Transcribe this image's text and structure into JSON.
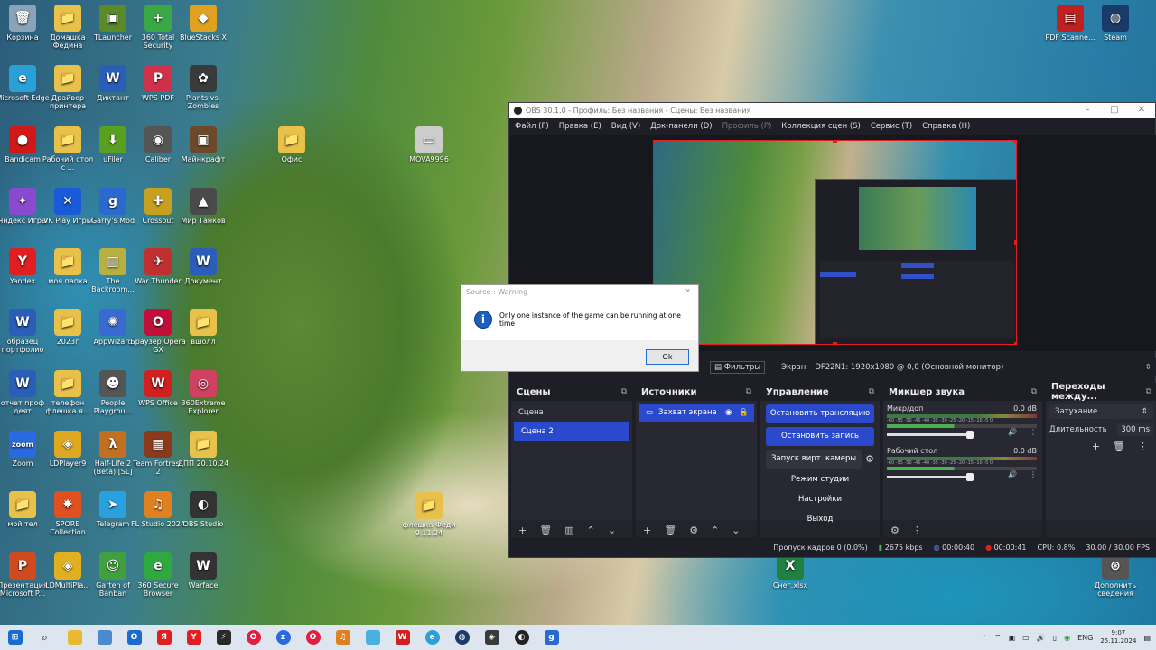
{
  "desktop": {
    "icons": [
      {
        "label": "Корзина",
        "glyph": "🗑",
        "color": "#8aa3b8"
      },
      {
        "label": "Домашка Федина",
        "glyph": "📁",
        "color": "#e8c14a"
      },
      {
        "label": "TLauncher",
        "glyph": "▣",
        "color": "#5a8a2a"
      },
      {
        "label": "360 Total Security",
        "glyph": "+",
        "color": "#3aa845"
      },
      {
        "label": "BlueStacks X",
        "glyph": "◆",
        "color": "#e0a020"
      },
      {
        "label": "Microsoft Edge",
        "glyph": "e",
        "color": "#2aa0d8"
      },
      {
        "label": "Драйвер принтера",
        "glyph": "📁",
        "color": "#e8c14a"
      },
      {
        "label": "Диктант",
        "glyph": "W",
        "color": "#2b5eb8"
      },
      {
        "label": "WPS PDF",
        "glyph": "P",
        "color": "#d0304a"
      },
      {
        "label": "Plants vs. Zombies",
        "glyph": "✿",
        "color": "#3a3a3a"
      },
      {
        "label": "Bandicam",
        "glyph": "●",
        "color": "#d01818"
      },
      {
        "label": "Рабочий стол с ...",
        "glyph": "📁",
        "color": "#e8c14a"
      },
      {
        "label": "uFiler",
        "glyph": "⬇",
        "color": "#5aa020"
      },
      {
        "label": "Caliber",
        "glyph": "◉",
        "color": "#555"
      },
      {
        "label": "Майнкрафт",
        "glyph": "▣",
        "color": "#6a4a2a"
      },
      {
        "label": "Яндекс Игры",
        "glyph": "✦",
        "color": "#8a4ad0"
      },
      {
        "label": "VK Play Игры",
        "glyph": "✕",
        "color": "#1a5ad8"
      },
      {
        "label": "Garry's Mod",
        "glyph": "g",
        "color": "#2a6ad0"
      },
      {
        "label": "Crossout",
        "glyph": "✚",
        "color": "#c8a020"
      },
      {
        "label": "Мир Танков",
        "glyph": "▲",
        "color": "#4a4a4a"
      },
      {
        "label": "Yandex",
        "glyph": "Y",
        "color": "#e02020"
      },
      {
        "label": "моя папка",
        "glyph": "📁",
        "color": "#e8c14a"
      },
      {
        "label": "The Backroom...",
        "glyph": "▥",
        "color": "#b8b040"
      },
      {
        "label": "War Thunder",
        "glyph": "✈",
        "color": "#c03030"
      },
      {
        "label": "Документ",
        "glyph": "W",
        "color": "#2b5eb8"
      },
      {
        "label": "образец портфолио",
        "glyph": "W",
        "color": "#2b5eb8"
      },
      {
        "label": "2023г",
        "glyph": "📁",
        "color": "#e8c14a"
      },
      {
        "label": "AppWizard",
        "glyph": "✺",
        "color": "#3a6ad0"
      },
      {
        "label": "Браузер Opera GX",
        "glyph": "O",
        "color": "#c0103a"
      },
      {
        "label": "вшолл",
        "glyph": "📁",
        "color": "#e8c14a"
      },
      {
        "label": "отчет проф деят",
        "glyph": "W",
        "color": "#2b5eb8"
      },
      {
        "label": "телефон флешка я...",
        "glyph": "📁",
        "color": "#e8c14a"
      },
      {
        "label": "People Playgrou...",
        "glyph": "☻",
        "color": "#555"
      },
      {
        "label": "WPS Office",
        "glyph": "W",
        "color": "#d02020"
      },
      {
        "label": "360Extreme Explorer",
        "glyph": "◎",
        "color": "#d04060"
      },
      {
        "label": "Zoom",
        "glyph": "zoom",
        "color": "#2a6ae0"
      },
      {
        "label": "LDPlayer9",
        "glyph": "◈",
        "color": "#e0a820"
      },
      {
        "label": "Half-Life 2 (Beta) [SL]",
        "glyph": "λ",
        "color": "#c07020"
      },
      {
        "label": "Team Fortress 2",
        "glyph": "▦",
        "color": "#8a3a1a"
      },
      {
        "label": "ДПП 20.10.24",
        "glyph": "📁",
        "color": "#e8c14a"
      },
      {
        "label": "мой тел",
        "glyph": "📁",
        "color": "#e8c14a"
      },
      {
        "label": "SPORE Collection",
        "glyph": "✸",
        "color": "#e05020"
      },
      {
        "label": "Telegram",
        "glyph": "➤",
        "color": "#2aa0e0"
      },
      {
        "label": "FL Studio 2024",
        "glyph": "♫",
        "color": "#e08020"
      },
      {
        "label": "OBS Studio",
        "glyph": "◐",
        "color": "#333"
      },
      {
        "label": "Презентация Microsoft P...",
        "glyph": "P",
        "color": "#d04a20"
      },
      {
        "label": "LDMultiPla...",
        "glyph": "◈",
        "color": "#e0b020"
      },
      {
        "label": "Garten of Banban",
        "glyph": "☺",
        "color": "#40a040"
      },
      {
        "label": "360 Secure Browser",
        "glyph": "e",
        "color": "#30a840"
      },
      {
        "label": "Warface",
        "glyph": "W",
        "color": "#333"
      },
      {
        "label": "PDF Scanne...",
        "glyph": "▤",
        "color": "#c02020"
      },
      {
        "label": "Steam",
        "glyph": "◍",
        "color": "#1a3a6a"
      },
      {
        "label": "Офис",
        "glyph": "📁",
        "color": "#e8c14a"
      },
      {
        "label": "MOVA9996",
        "glyph": "▭",
        "color": "#ccc"
      },
      {
        "label": "флешка Феди 9.11.24",
        "glyph": "📁",
        "color": "#e8c14a"
      },
      {
        "label": "Снег.xlsx",
        "glyph": "X",
        "color": "#208040"
      },
      {
        "label": "Дополнить сведения",
        "glyph": "⊛",
        "color": "#555"
      }
    ]
  },
  "obs": {
    "title": "OBS 30.1.0 - Профиль: Без названия - Сцены: Без названия",
    "menu": [
      "Файл (F)",
      "Правка (E)",
      "Вид (V)",
      "Док-панели (D)",
      "Профиль (P)",
      "Коллекция сцен (S)",
      "Сервис (T)",
      "Справка (H)"
    ],
    "source_toolbar": {
      "filters": "Фильтры",
      "screen_label": "Экран",
      "screen_value": "DF22N1: 1920x1080 @ 0,0 (Основной монитор)"
    },
    "scenes": {
      "title": "Сцены",
      "items": [
        "Сцена",
        "Сцена 2"
      ],
      "selected": 1
    },
    "sources": {
      "title": "Источники",
      "items": [
        "Захват экрана"
      ]
    },
    "controls": {
      "title": "Управление",
      "stop_stream": "Остановить трансляцию",
      "stop_record": "Остановить запись",
      "virtual_cam": "Запуск вирт. камеры",
      "studio_mode": "Режим студии",
      "settings": "Настройки",
      "exit": "Выход"
    },
    "mixer": {
      "title": "Микшер звука",
      "channels": [
        {
          "name": "Микр/доп",
          "db": "0.0 dB"
        },
        {
          "name": "Рабочий стол",
          "db": "0.0 dB"
        }
      ],
      "scale": "-60 -55 -50 -45 -40 -35 -30 -25 -20 -15 -10 -5 0"
    },
    "transitions": {
      "title": "Переходы между...",
      "type": "Затухание",
      "duration_label": "Длительность",
      "duration": "300 ms"
    },
    "status": {
      "dropped": "Пропуск кадров 0 (0.0%)",
      "bitrate": "2675 kbps",
      "stream_time": "00:00:40",
      "rec_time": "00:00:41",
      "cpu": "CPU: 0.8%",
      "fps": "30.00 / 30.00 FPS"
    }
  },
  "dialog": {
    "title": "Source : Warning",
    "message": "Only one instance of the game can be running at one time",
    "ok": "Ok"
  },
  "taskbar": {
    "lang": "ENG",
    "time": "9:07",
    "date": "25.11.2024"
  }
}
